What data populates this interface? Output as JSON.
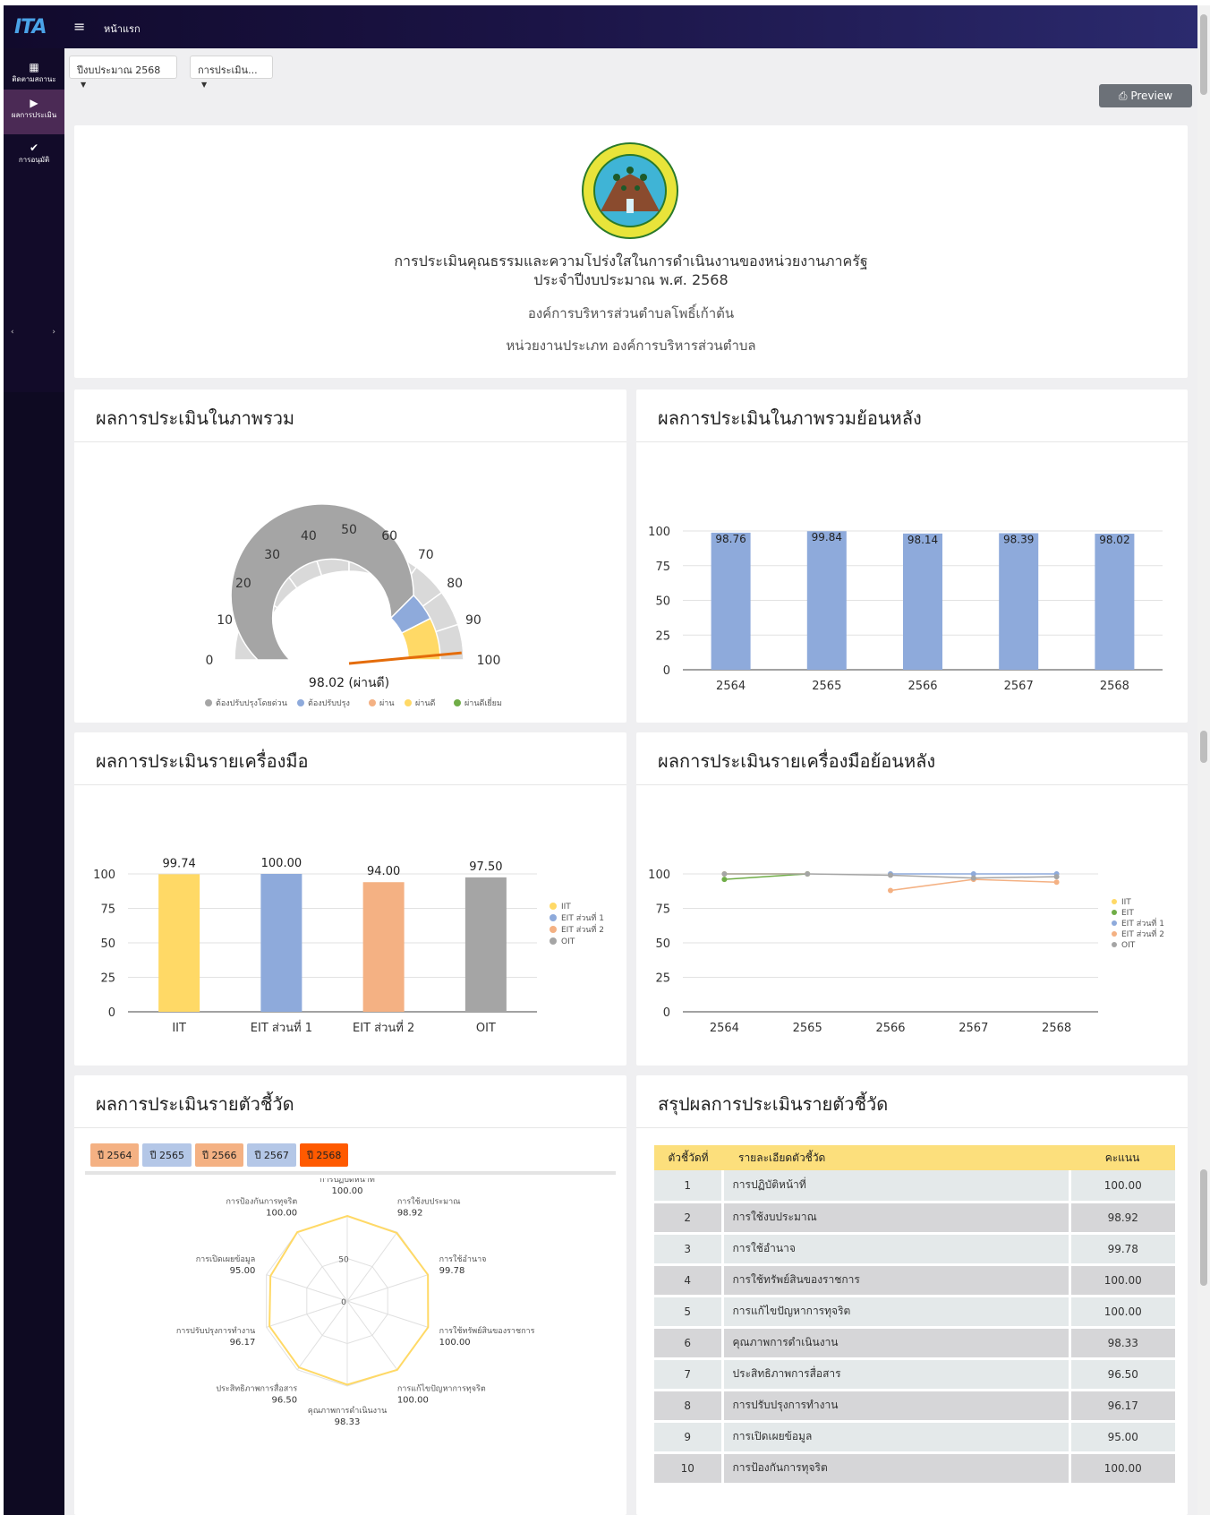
{
  "topbar": {
    "logo": "ITA",
    "home_label": "หน้าแรก"
  },
  "sidebar": {
    "items": [
      {
        "icon": "chart-icon",
        "label": "ติดตามสถานะ"
      },
      {
        "icon": "play-icon",
        "label": "ผลการประเมิน"
      },
      {
        "icon": "clipboard-check-icon",
        "label": "การอนุมัติ"
      }
    ]
  },
  "filters": {
    "year": "ปีงบประมาณ 2568",
    "type": "การประเมิน..."
  },
  "preview_label": "Preview",
  "header": {
    "title1": "การประเมินคุณธรรมและความโปร่งใสในการดำเนินงานของหน่วยงานภาครัฐ",
    "title2": "ประจำปีงบประมาณ พ.ศ. 2568",
    "org": "องค์การบริหารส่วนตำบลโพธิ์เก้าต้น",
    "org_type": "หน่วยงานประเภท องค์การบริหารส่วนตำบล"
  },
  "cards": {
    "overall": "ผลการประเมินในภาพรวม",
    "overall_history": "ผลการประเมินในภาพรวมย้อนหลัง",
    "by_tool": "ผลการประเมินรายเครื่องมือ",
    "by_tool_history": "ผลการประเมินรายเครื่องมือย้อนหลัง",
    "by_indicator": "ผลการประเมินรายตัวชี้วัด",
    "indicator_summary": "สรุปผลการประเมินรายตัวชี้วัด"
  },
  "colors": {
    "blue": "#8eaadb",
    "yellow": "#ffd966",
    "orange": "#f4b183",
    "gray": "#a5a5a5",
    "green": "#70ad47",
    "red": "#ff5a00"
  },
  "chart_data": [
    {
      "type": "gauge",
      "value": 98.02,
      "label": "98.02 (ผ่านดี)",
      "ticks": [
        0,
        10,
        20,
        30,
        40,
        50,
        60,
        70,
        80,
        90,
        100
      ],
      "bands": [
        {
          "name": "ต้องปรับปรุงโดยด่วน",
          "from": 0,
          "to": 75,
          "color": "#a5a5a5"
        },
        {
          "name": "ต้องปรับปรุง",
          "from": 75,
          "to": 85,
          "color": "#8eaadb"
        },
        {
          "name": "ผ่าน",
          "from": 85,
          "to": 85,
          "color": "#f4b183"
        },
        {
          "name": "ผ่านดี",
          "from": 85,
          "to": 100,
          "color": "#ffd966"
        },
        {
          "name": "ผ่านดีเยี่ยม",
          "from": 100,
          "to": 100,
          "color": "#70ad47"
        }
      ]
    },
    {
      "type": "bar",
      "categories": [
        "2564",
        "2565",
        "2566",
        "2567",
        "2568"
      ],
      "values": [
        98.76,
        99.84,
        98.14,
        98.39,
        98.02
      ],
      "value_labels": [
        "98.76",
        "99.84",
        "98.14",
        "98.39",
        "98.02"
      ],
      "yticks": [
        0,
        25,
        50,
        75,
        100
      ],
      "ylim": [
        0,
        100
      ],
      "grid": true
    },
    {
      "type": "bar",
      "categories": [
        "IIT",
        "EIT ส่วนที่ 1",
        "EIT ส่วนที่ 2",
        "OIT"
      ],
      "values": [
        99.74,
        100.0,
        94.0,
        97.5
      ],
      "value_labels": [
        "99.74",
        "100.00",
        "94.00",
        "97.50"
      ],
      "legend": [
        "IIT",
        "EIT ส่วนที่ 1",
        "EIT ส่วนที่ 2",
        "OIT"
      ],
      "yticks": [
        0,
        25,
        50,
        75,
        100
      ],
      "ylim": [
        0,
        100
      ],
      "legend_position": "right"
    },
    {
      "type": "line",
      "x": [
        "2564",
        "2565",
        "2566",
        "2567",
        "2568"
      ],
      "series": [
        {
          "name": "IIT",
          "values": [
            100,
            100,
            null,
            null,
            null
          ]
        },
        {
          "name": "EIT",
          "values": [
            96,
            100,
            null,
            null,
            null
          ]
        },
        {
          "name": "EIT ส่วนที่ 1",
          "values": [
            null,
            null,
            100,
            100,
            100
          ]
        },
        {
          "name": "EIT ส่วนที่ 2",
          "values": [
            null,
            null,
            88,
            96,
            94
          ]
        },
        {
          "name": "OIT",
          "values": [
            100,
            100,
            99,
            97,
            98
          ]
        }
      ],
      "yticks": [
        0,
        25,
        50,
        75,
        100
      ],
      "ylim": [
        0,
        100
      ],
      "legend_position": "right"
    },
    {
      "type": "radar",
      "year_tags": [
        "ปี 2564",
        "ปี 2565",
        "ปี 2566",
        "ปี 2567",
        "ปี 2568"
      ],
      "axes": [
        "การปฏิบัติหน้าที่",
        "การใช้งบประมาณ",
        "การใช้อำนาจ",
        "การใช้ทรัพย์สินของราชการ",
        "การแก้ไขปัญหาการทุจริต",
        "คุณภาพการดำเนินงาน",
        "ประสิทธิภาพการสื่อสาร",
        "การปรับปรุงการทำงาน",
        "การเปิดเผยข้อมูล",
        "การป้องกันการทุจริต"
      ],
      "values": [
        100.0,
        98.92,
        99.78,
        100.0,
        100.0,
        98.33,
        96.5,
        96.17,
        95.0,
        100.0
      ],
      "value_labels": [
        "100.00",
        "98.92",
        "99.78",
        "100.00",
        "100.00",
        "98.33",
        "96.50",
        "96.17",
        "95.00",
        "100.00"
      ],
      "rticks": [
        "0",
        "50"
      ]
    }
  ],
  "table": {
    "headers": [
      "ตัวชี้วัดที่",
      "รายละเอียดตัวชี้วัด",
      "คะแนน"
    ],
    "rows": [
      [
        "1",
        "การปฏิบัติหน้าที่",
        "100.00"
      ],
      [
        "2",
        "การใช้งบประมาณ",
        "98.92"
      ],
      [
        "3",
        "การใช้อำนาจ",
        "99.78"
      ],
      [
        "4",
        "การใช้ทรัพย์สินของราชการ",
        "100.00"
      ],
      [
        "5",
        "การแก้ไขปัญหาการทุจริต",
        "100.00"
      ],
      [
        "6",
        "คุณภาพการดำเนินงาน",
        "98.33"
      ],
      [
        "7",
        "ประสิทธิภาพการสื่อสาร",
        "96.50"
      ],
      [
        "8",
        "การปรับปรุงการทำงาน",
        "96.17"
      ],
      [
        "9",
        "การเปิดเผยข้อมูล",
        "95.00"
      ],
      [
        "10",
        "การป้องกันการทุจริต",
        "100.00"
      ]
    ]
  }
}
